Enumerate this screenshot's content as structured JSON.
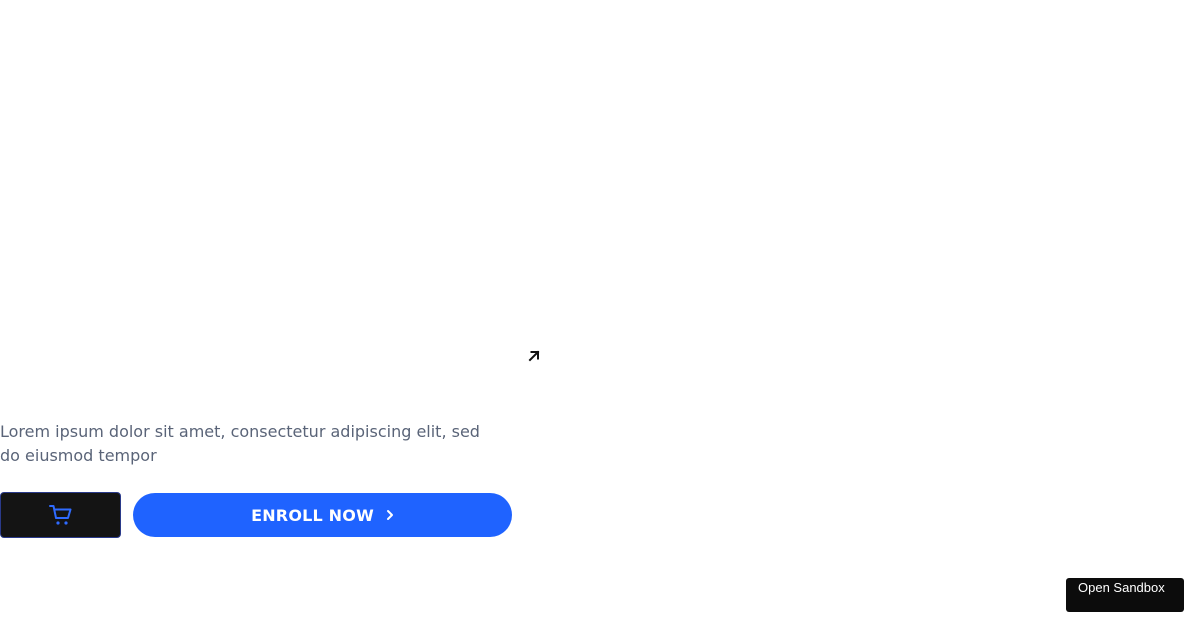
{
  "hero": {
    "description": "Lorem ipsum dolor sit amet, consectetur adipiscing elit, sed do eiusmod tempor",
    "arrow_icon": "arrow-up-right-icon"
  },
  "actions": {
    "cart_icon": "shopping-cart-icon",
    "enroll_label": "ENROLL NOW",
    "enroll_icon": "chevron-right-icon"
  },
  "sandbox": {
    "label": "Open Sandbox"
  },
  "colors": {
    "primary": "#1f63ff",
    "cart_bg": "#141414",
    "text_muted": "#5a6478"
  }
}
